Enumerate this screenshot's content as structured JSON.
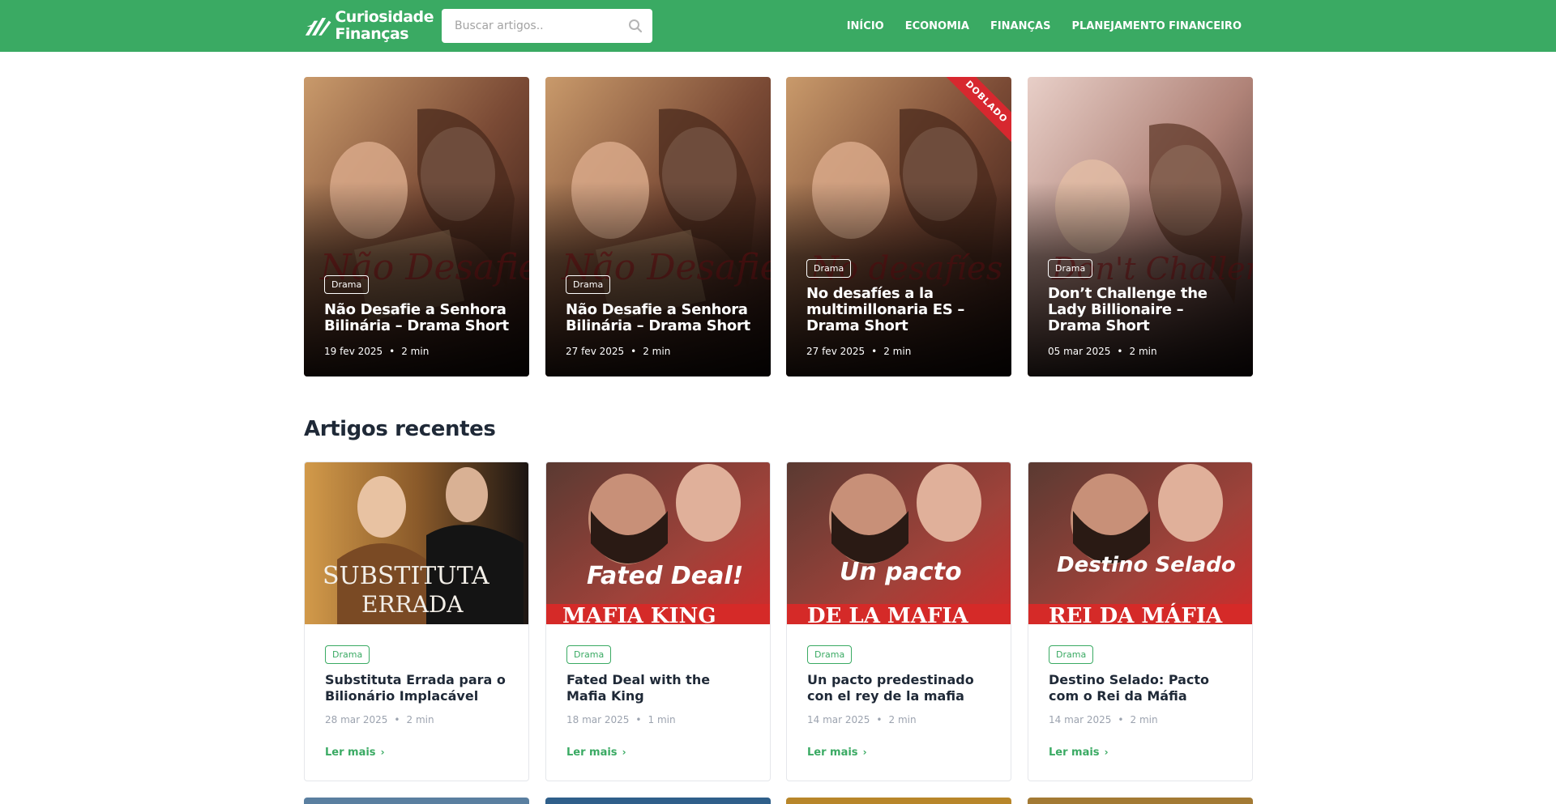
{
  "brand": {
    "line1": "Curiosidade",
    "line2": "Finanças",
    "color": "#3aaa63"
  },
  "search": {
    "placeholder": "Buscar artigos..",
    "icon": "search-icon"
  },
  "nav": {
    "items": [
      {
        "label": "INÍCIO"
      },
      {
        "label": "ECONOMIA"
      },
      {
        "label": "FINANÇAS"
      },
      {
        "label": "PLANEJAMENTO FINANCEIRO"
      }
    ]
  },
  "featured": [
    {
      "tag": "Drama",
      "title": "Não Desafie a Senhora Bilinária – Drama Short",
      "date": "19 fev 2025",
      "read": "2 min"
    },
    {
      "tag": "Drama",
      "title": "Não Desafie a Senhora Bilinária – Drama Short",
      "date": "27 fev 2025",
      "read": "2 min"
    },
    {
      "tag": "Drama",
      "title": "No desafíes a la multimillonaria ES – Drama Short",
      "date": "27 fev 2025",
      "read": "2 min",
      "ribbon": "DOBLADO"
    },
    {
      "tag": "Drama",
      "title": "Don’t Challenge the Lady Billionaire – Drama Short",
      "date": "05 mar 2025",
      "read": "2 min"
    }
  ],
  "recent": {
    "heading": "Artigos recentes",
    "read_more": "Ler mais",
    "items": [
      {
        "tag": "Drama",
        "title": "Substituta Errada para o Bilionário Implacável",
        "date": "28 mar 2025",
        "read": "2 min"
      },
      {
        "tag": "Drama",
        "title": "Fated Deal with the Mafia King",
        "date": "18 mar 2025",
        "read": "1 min"
      },
      {
        "tag": "Drama",
        "title": "Un pacto predestinado con el rey de la mafia",
        "date": "14 mar 2025",
        "read": "2 min"
      },
      {
        "tag": "Drama",
        "title": "Destino Selado: Pacto com o Rei da Máfia",
        "date": "14 mar 2025",
        "read": "2 min"
      }
    ]
  },
  "meta_separator": "•",
  "chevron": "›"
}
